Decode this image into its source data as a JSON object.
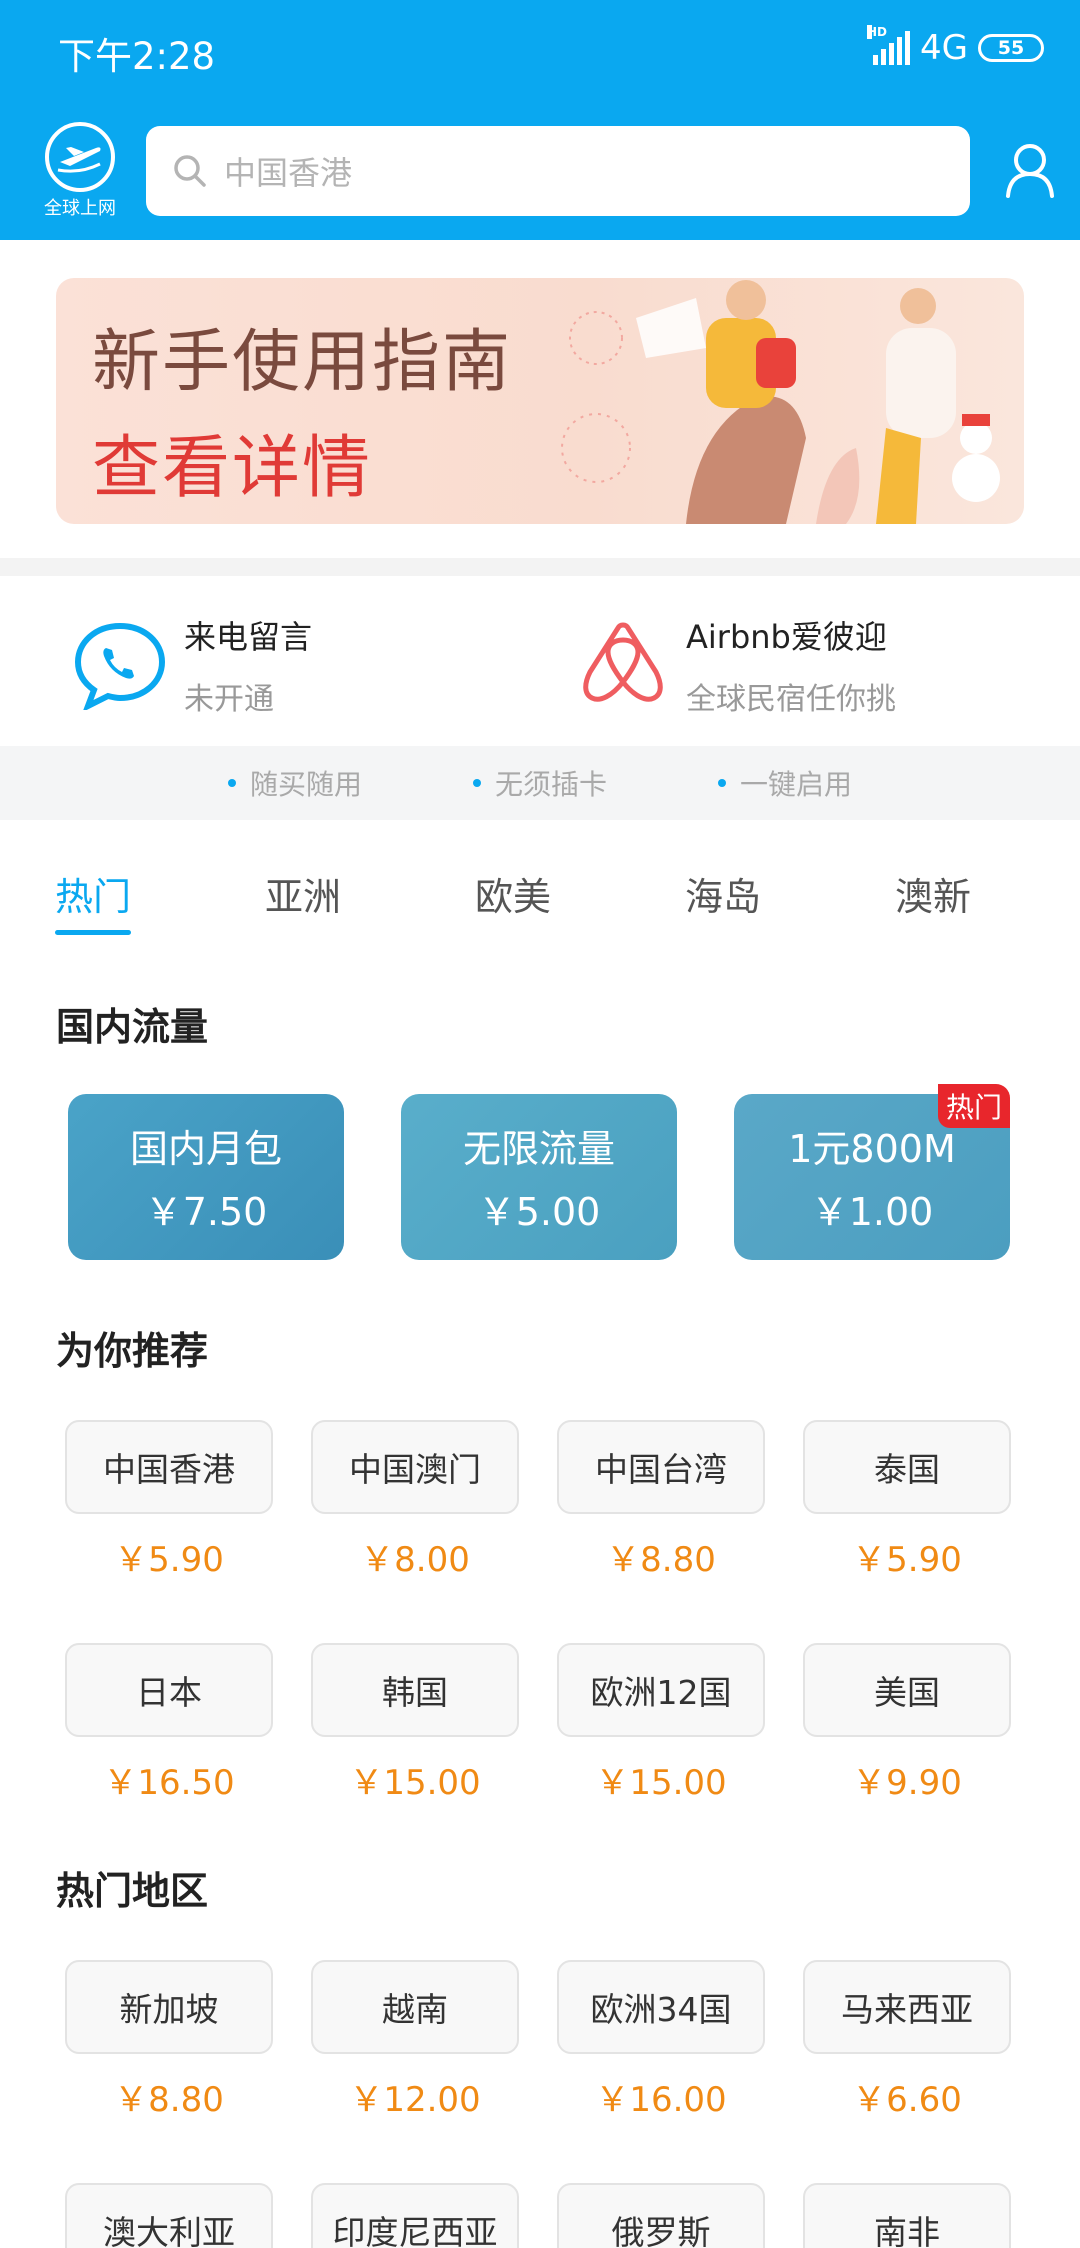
{
  "status_bar": {
    "time": "下午2:28",
    "network": "4G",
    "battery": "55",
    "hd": "HD"
  },
  "header": {
    "logo_label": "全球上网",
    "search_placeholder": "中国香港"
  },
  "banner": {
    "line1": "新手使用指南",
    "line2": "查看详情"
  },
  "features": [
    {
      "title": "来电留言",
      "subtitle": "未开通",
      "icon": "phone-chat-icon"
    },
    {
      "title": "Airbnb爱彼迎",
      "subtitle": "全球民宿任你挑",
      "icon": "airbnb-icon"
    }
  ],
  "tips": [
    "随买随用",
    "无须插卡",
    "一键启用"
  ],
  "tabs": [
    "热门",
    "亚洲",
    "欧美",
    "海岛",
    "澳新"
  ],
  "domestic": {
    "title": "国内流量",
    "cards": [
      {
        "name": "国内月包",
        "price": "￥7.50",
        "badge": ""
      },
      {
        "name": "无限流量",
        "price": "￥5.00",
        "badge": ""
      },
      {
        "name": "1元800M",
        "price": "￥1.00",
        "badge": "热门"
      }
    ]
  },
  "recommend": {
    "title": "为你推荐",
    "items": [
      {
        "name": "中国香港",
        "price": "￥5.90"
      },
      {
        "name": "中国澳门",
        "price": "￥8.00"
      },
      {
        "name": "中国台湾",
        "price": "￥8.80"
      },
      {
        "name": "泰国",
        "price": "￥5.90"
      },
      {
        "name": "日本",
        "price": "￥16.50"
      },
      {
        "name": "韩国",
        "price": "￥15.00"
      },
      {
        "name": "欧洲12国",
        "price": "￥15.00"
      },
      {
        "name": "美国",
        "price": "￥9.90"
      }
    ]
  },
  "hot_regions": {
    "title": "热门地区",
    "items": [
      {
        "name": "新加坡",
        "price": "￥8.80"
      },
      {
        "name": "越南",
        "price": "￥12.00"
      },
      {
        "name": "欧洲34国",
        "price": "￥16.00"
      },
      {
        "name": "马来西亚",
        "price": "￥6.60"
      },
      {
        "name": "澳大利亚",
        "price": ""
      },
      {
        "name": "印度尼西亚",
        "price": ""
      },
      {
        "name": "俄罗斯",
        "price": ""
      },
      {
        "name": "南非",
        "price": ""
      }
    ]
  },
  "colors": {
    "brand": "#0aa8f0",
    "price": "#f08a14",
    "hot": "#e8262c"
  }
}
